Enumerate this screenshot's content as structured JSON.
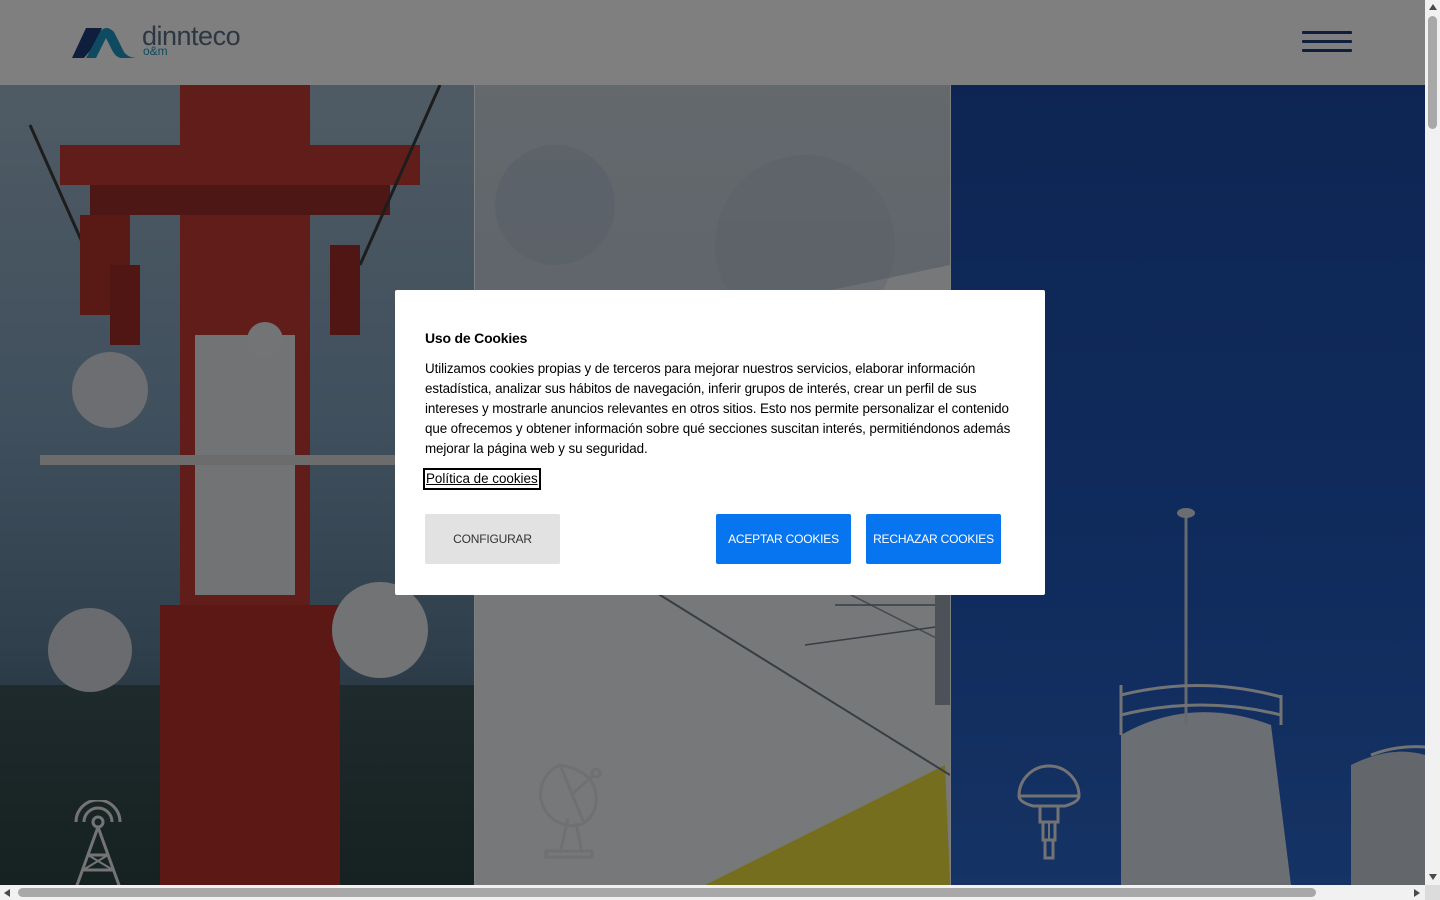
{
  "header": {
    "logo": {
      "name": "dinnteco",
      "sub": "o&m",
      "icon": "dinnteco-mark-icon",
      "colors": {
        "mark_dark": "#1f3d79",
        "mark_light": "#1d94c0",
        "name": "#5a6f86"
      }
    },
    "menu_icon": "hamburger-menu-icon",
    "menu_color": "#1f3d79"
  },
  "services": [
    {
      "image": "telecom-tower-photo",
      "icon": "radio-tower-icon"
    },
    {
      "image": "blueprint-plans-photo",
      "icon": "satellite-dish-icon"
    },
    {
      "image": "industrial-tanks-photo",
      "icon": "gnss-antenna-icon"
    }
  ],
  "cookie_banner": {
    "title": "Uso de Cookies",
    "text": "Utilizamos cookies propias y de terceros para mejorar nuestros servicios, elaborar información estadística, analizar sus hábitos de navegación, inferir grupos de interés, crear un perfil de sus intereses y mostrarle anuncios relevantes en otros sitios. Esto nos permite personalizar el contenido que ofrecemos y obtener información sobre qué secciones suscitan interés, permitiéndonos además mejorar la página web y su seguridad.",
    "policy_link": "Política de cookies",
    "buttons": {
      "configure": "Configurar",
      "accept": "Aceptar cookies",
      "reject": "Rechazar cookies"
    },
    "colors": {
      "primary": "#0875f0",
      "secondary": "#e2e2e2"
    }
  }
}
